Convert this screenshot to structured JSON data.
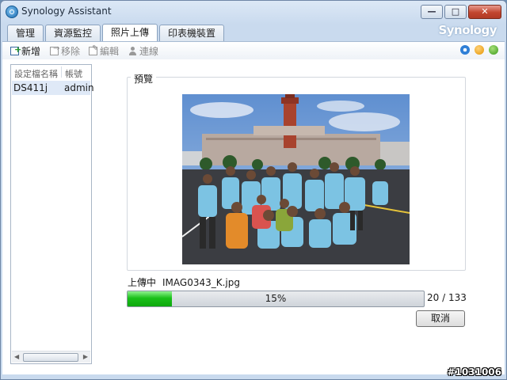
{
  "window": {
    "title": "Synology Assistant"
  },
  "brand": "Synology",
  "tabs": [
    {
      "label": "管理",
      "active": false
    },
    {
      "label": "資源監控",
      "active": false
    },
    {
      "label": "照片上傳",
      "active": true
    },
    {
      "label": "印表機裝置",
      "active": false
    }
  ],
  "toolbar": {
    "add": "新增",
    "move": "移除",
    "edit": "編輯",
    "connect": "連線"
  },
  "status_icons": [
    "gear-icon",
    "warning-icon",
    "online-icon"
  ],
  "list": {
    "headers": [
      "設定檔名稱",
      "帳號"
    ],
    "rows": [
      {
        "profile": "DS411j",
        "account": "admin"
      }
    ]
  },
  "preview": {
    "label": "預覽"
  },
  "upload": {
    "status": "上傳中",
    "filename": "IMAG0343_K.jpg",
    "progress_text": "15%",
    "progress_fraction": 0.15,
    "count": "20 / 133",
    "cancel": "取消"
  },
  "watermark": "#1031006",
  "colors": {
    "progress": "#19c019",
    "accent": "#2f7fd6"
  }
}
